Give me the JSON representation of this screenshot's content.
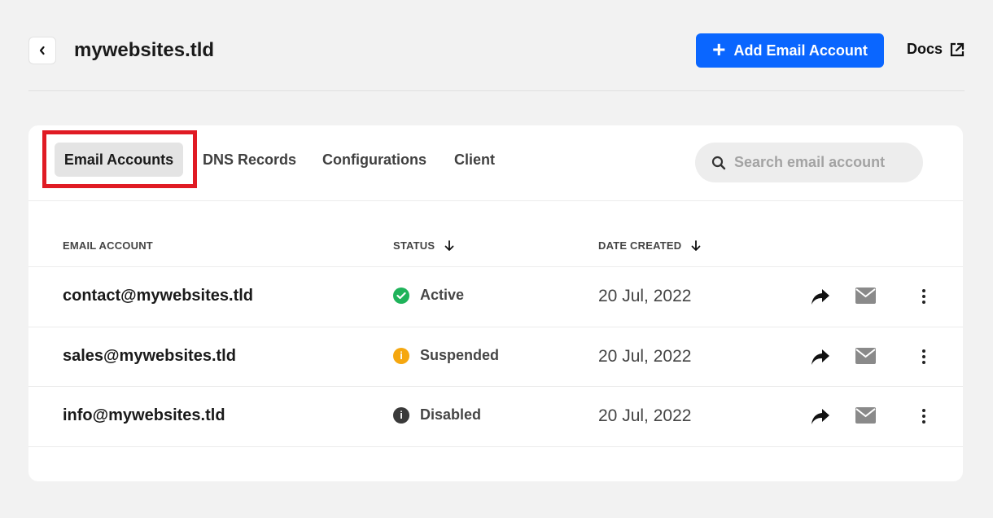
{
  "header": {
    "back_icon": "chevron-left-icon",
    "title": "mywebsites.tld",
    "add_button_label": "Add Email Account",
    "add_icon": "plus-icon",
    "docs_label": "Docs",
    "docs_icon": "external-link-icon",
    "accent_color": "#0a66ff"
  },
  "tabs": [
    {
      "label": "Email Accounts",
      "active": true
    },
    {
      "label": "DNS Records",
      "active": false
    },
    {
      "label": "Configurations",
      "active": false
    },
    {
      "label": "Client",
      "active": false
    }
  ],
  "search": {
    "placeholder": "Search email account",
    "icon": "search-icon"
  },
  "table": {
    "columns": [
      {
        "label": "EMAIL ACCOUNT"
      },
      {
        "label": "STATUS",
        "sort_icon": "arrow-down-icon"
      },
      {
        "label": "DATE CREATED",
        "sort_icon": "arrow-down-icon"
      }
    ],
    "rows": [
      {
        "email": "contact@mywebsites.tld",
        "status": "Active",
        "status_color": "#1fb35a",
        "status_icon": "check-circle-icon",
        "date": "20 Jul, 2022"
      },
      {
        "email": "sales@mywebsites.tld",
        "status": "Suspended",
        "status_color": "#f5a70f",
        "status_icon": "info-circle-icon",
        "date": "20 Jul, 2022"
      },
      {
        "email": "info@mywebsites.tld",
        "status": "Disabled",
        "status_color": "#3a3a3a",
        "status_icon": "info-circle-icon",
        "date": "20 Jul, 2022"
      }
    ],
    "row_actions": [
      "forward-icon",
      "mail-icon",
      "more-vertical-icon"
    ]
  },
  "highlight_color": "#e01b24"
}
